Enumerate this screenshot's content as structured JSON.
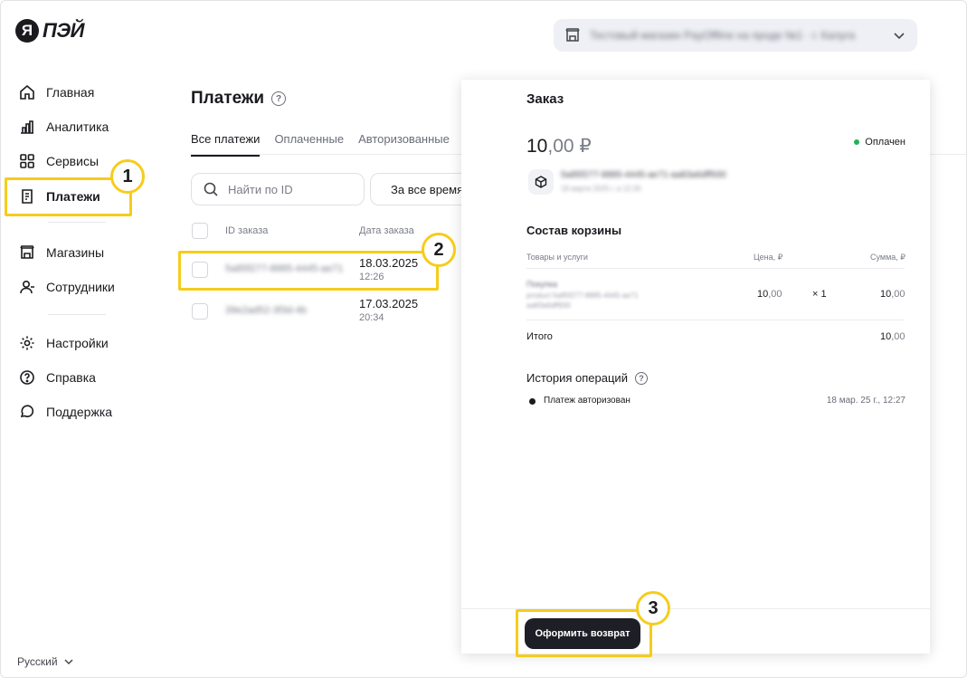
{
  "brand": {
    "logo_letter": "Я",
    "logo_text": "ПЭЙ"
  },
  "shop_selector": {
    "value": "Тестовый магазин PayOffline на проде №1 · г. Калуга",
    "icon": "shop-icon",
    "chevron": "chevron-down-icon"
  },
  "sidebar": {
    "items": [
      {
        "label": "Главная",
        "icon": "home-icon"
      },
      {
        "label": "Аналитика",
        "icon": "chart-icon"
      },
      {
        "label": "Сервисы",
        "icon": "grid-icon"
      },
      {
        "label": "Платежи",
        "icon": "receipt-icon"
      },
      {
        "label": "Магазины",
        "icon": "shop-icon"
      },
      {
        "label": "Сотрудники",
        "icon": "users-icon"
      },
      {
        "label": "Настройки",
        "icon": "gear-icon"
      },
      {
        "label": "Справка",
        "icon": "help-icon"
      },
      {
        "label": "Поддержка",
        "icon": "chat-icon"
      }
    ],
    "language": "Русский"
  },
  "callouts": {
    "one": "1",
    "two": "2",
    "three": "3"
  },
  "colors": {
    "highlight": "#f6cc1c",
    "status_paid": "#1fb35a",
    "button_dark": "#1e1f26"
  },
  "payments": {
    "title": "Платежи",
    "tabs": [
      "Все платежи",
      "Оплаченные",
      "Авторизованные"
    ],
    "search_placeholder": "Найти по ID",
    "date_filter": "За все время",
    "columns": {
      "order_id": "ID заказа",
      "order_date": "Дата заказа"
    },
    "rows": [
      {
        "id": "5a85f277-8885-4445-ae71",
        "date": "18.03.2025",
        "time": "12:26"
      },
      {
        "id": "39e2ad52-3f3d-4b",
        "date": "17.03.2025",
        "time": "20:34"
      }
    ]
  },
  "order": {
    "title": "Заказ",
    "amount_int": "10",
    "amount_dec": ",00 ₽",
    "status": "Оплачен",
    "order_uid": "5a85f277-8885-4445-ae71-aa83a6dff930",
    "order_created": "18 марта 2025 г. в 12:26",
    "cart_title": "Состав корзины",
    "cart_columns": {
      "goods": "Товары и услуги",
      "price": "Цена, ₽",
      "sum": "Сумма, ₽"
    },
    "cart_items": [
      {
        "name": "Покупка",
        "desc1": "product 5a85f277-8885-4445-ae71",
        "desc2": "aa83a6dff930",
        "price_int": "10",
        "price_dec": ",00",
        "qty": "× 1",
        "sum_int": "10",
        "sum_dec": ",00"
      }
    ],
    "total_label": "Итого",
    "total_int": "10",
    "total_dec": ",00",
    "history_title": "История операций",
    "history": [
      {
        "label": "Платеж авторизован",
        "date": "18 мар. 25 г., 12:27"
      }
    ],
    "refund_button": "Оформить возврат"
  }
}
